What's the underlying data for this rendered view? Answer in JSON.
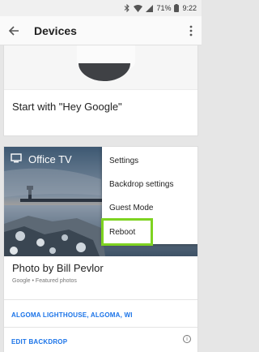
{
  "statusbar": {
    "battery": "71%",
    "time": "9:22"
  },
  "appbar": {
    "title": "Devices"
  },
  "google_home_card": {
    "caption": "Start with \"Hey Google\""
  },
  "device_card": {
    "device_name": "Office TV",
    "menu": [
      "Settings",
      "Backdrop settings",
      "Guest Mode",
      "Reboot"
    ],
    "photo_credit": "Photo by Bill Pevlor",
    "photo_source": "Google • Featured photos",
    "location_link": "ALGOMA LIGHTHOUSE, ALGOMA, WI",
    "edit_link": "EDIT BACKDROP"
  },
  "colors": {
    "highlight": "#7ed321",
    "link": "#1a73e8"
  }
}
